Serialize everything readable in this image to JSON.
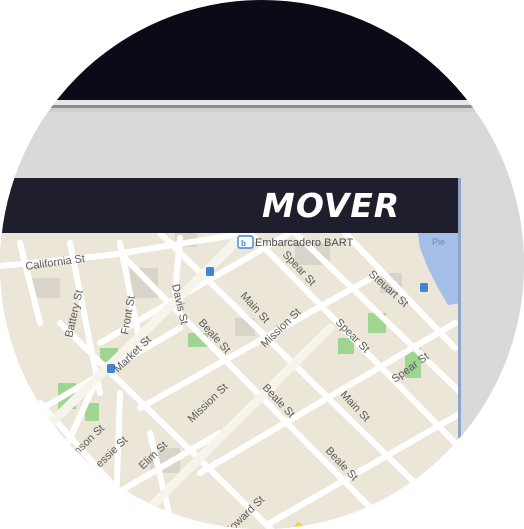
{
  "app": {
    "logo_text": "MOVER"
  },
  "map": {
    "transit_station": "Embarcadero BART",
    "streets": [
      "California St",
      "Davis St",
      "Spear St",
      "Steuart St",
      "Battery St",
      "Front St",
      "Main St",
      "Beale St",
      "Mission St",
      "Market St",
      "Howard St",
      "Elim St",
      "nson St",
      "essie St",
      "Pie"
    ]
  },
  "colors": {
    "header_bg": "#1f1e2c",
    "map_land": "#ece6d8",
    "map_water": "#a5bee8",
    "map_park": "#9ed591"
  }
}
